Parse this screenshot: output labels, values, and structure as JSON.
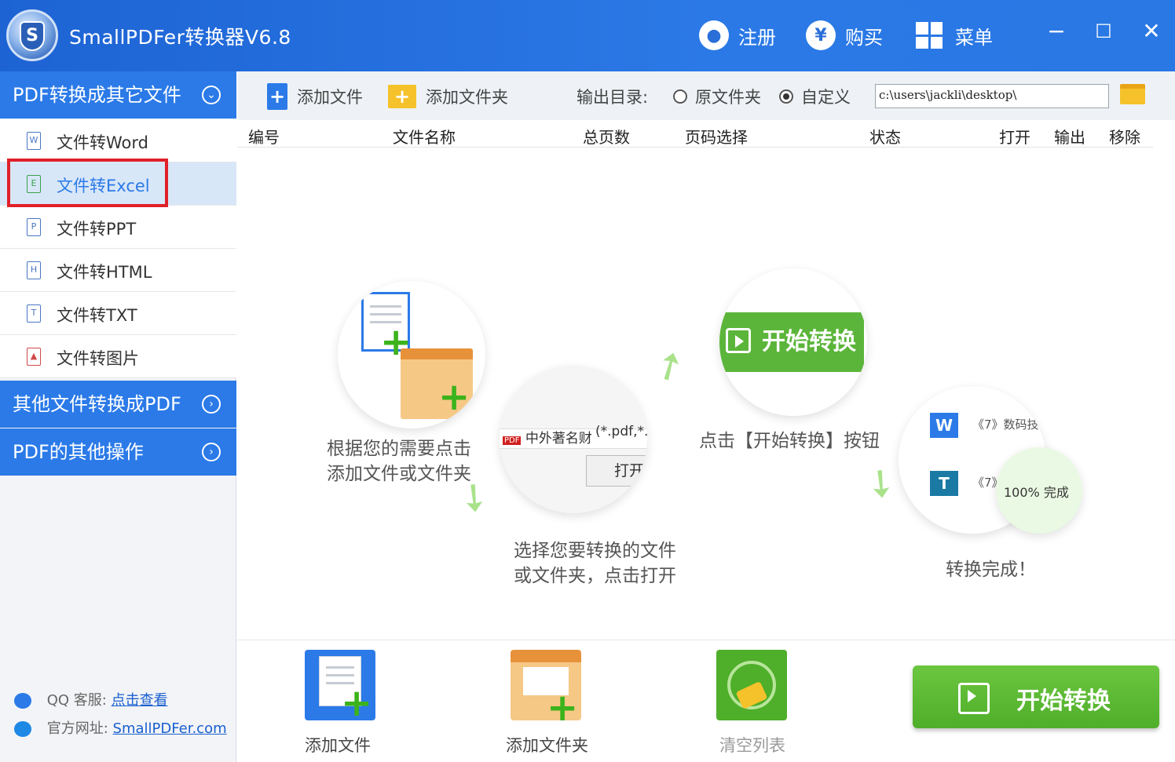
{
  "app": {
    "title": "SmallPDFer转换器V6.8",
    "register": "注册",
    "buy": "购买",
    "menu": "菜单",
    "minimize": "−",
    "maximize": "☐",
    "close": "✕"
  },
  "sidebar": {
    "section1": "PDF转换成其它文件",
    "items": [
      {
        "label": "文件转Word",
        "icon": "W"
      },
      {
        "label": "文件转Excel",
        "icon": "E"
      },
      {
        "label": "文件转PPT",
        "icon": "P"
      },
      {
        "label": "文件转HTML",
        "icon": "H"
      },
      {
        "label": "文件转TXT",
        "icon": "T"
      },
      {
        "label": "文件转图片",
        "icon": "▲"
      }
    ],
    "section2": "其他文件转换成PDF",
    "section3": "PDF的其他操作",
    "qq_label": "QQ 客服:",
    "qq_link": "点击查看",
    "site_label": "官方网址:",
    "site_link": "SmallPDFer.com"
  },
  "toolbar": {
    "add_file": "添加文件",
    "add_folder": "添加文件夹",
    "output_dir": "输出目录:",
    "opt_source": "原文件夹",
    "opt_custom": "自定义",
    "path": "c:\\users\\jackli\\desktop\\"
  },
  "table": {
    "cols": [
      "编号",
      "文件名称",
      "总页数",
      "页码选择",
      "状态",
      "打开",
      "输出",
      "移除"
    ]
  },
  "guide": {
    "step1": [
      "根据您的需要点击",
      "添加文件或文件夹"
    ],
    "step2": [
      "选择您要转换的文件",
      "或文件夹，点击打开"
    ],
    "step3": "点击【开始转换】按钮",
    "step4": "转换完成！",
    "pill": "开始转换",
    "dialog_file": "中外著名财",
    "dialog_ext": "(*.pdf,*.",
    "dialog_open": "打开",
    "done_item1": "《7》数码技",
    "done_item2": "《7》",
    "done_status": "100%  完成"
  },
  "bottom": {
    "add_file": "添加文件",
    "add_folder": "添加文件夹",
    "clear": "清空列表",
    "start": "开始转换"
  }
}
